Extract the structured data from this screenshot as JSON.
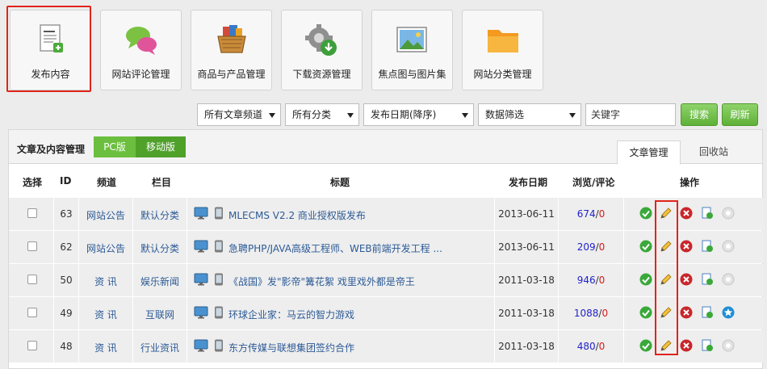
{
  "tiles": [
    {
      "label": "发布内容",
      "icon": "document-add-icon"
    },
    {
      "label": "网站评论管理",
      "icon": "chat-bubbles-icon"
    },
    {
      "label": "商品与产品管理",
      "icon": "shopping-basket-icon"
    },
    {
      "label": "下载资源管理",
      "icon": "download-gear-icon"
    },
    {
      "label": "焦点图与图片集",
      "icon": "picture-icon"
    },
    {
      "label": "网站分类管理",
      "icon": "folder-icon"
    }
  ],
  "filters": {
    "channel": "所有文章频道",
    "category": "所有分类",
    "sort": "发布日期(降序)",
    "data_filter": "数据筛选",
    "keyword": "关键字",
    "search_label": "搜索",
    "refresh_label": "刷新"
  },
  "panel": {
    "title": "文章及内容管理",
    "pc_label": "PC版",
    "mobile_label": "移动版",
    "tab_active": "文章管理",
    "tab_inactive": "回收站"
  },
  "columns": {
    "select": "选择",
    "id": "ID",
    "channel": "频道",
    "category": "栏目",
    "title": "标题",
    "date": "发布日期",
    "stats": "浏览/评论",
    "ops": "操作"
  },
  "rows": [
    {
      "id": "63",
      "channel": "网站公告",
      "category": "默认分类",
      "title": "MLECMS V2.2 商业授权版发布",
      "date": "2013-06-11",
      "views": "674",
      "slash": "/",
      "comments": "0"
    },
    {
      "id": "62",
      "channel": "网站公告",
      "category": "默认分类",
      "title": "急聘PHP/JAVA高级工程师、WEB前端开发工程 ...",
      "date": "2013-06-11",
      "views": "209",
      "slash": "/",
      "comments": "0"
    },
    {
      "id": "50",
      "channel": "资 讯",
      "category": "娱乐新闻",
      "title": "《战国》发\"影帝\"篝花絮 戏里戏外都是帝王",
      "date": "2011-03-18",
      "views": "946",
      "slash": "/",
      "comments": "0"
    },
    {
      "id": "49",
      "channel": "资 讯",
      "category": "互联网",
      "title": "环球企业家：马云的智力游戏",
      "date": "2011-03-18",
      "views": "1088",
      "slash": "/",
      "comments": "0"
    },
    {
      "id": "48",
      "channel": "资 讯",
      "category": "行业资讯",
      "title": "东方传媒与联想集团签约合作",
      "date": "2011-03-18",
      "views": "480",
      "slash": "/",
      "comments": "0"
    }
  ],
  "colors": {
    "accent_green": "#5fb039",
    "highlight_red": "#e0241c",
    "link_blue": "#2c5a96"
  }
}
